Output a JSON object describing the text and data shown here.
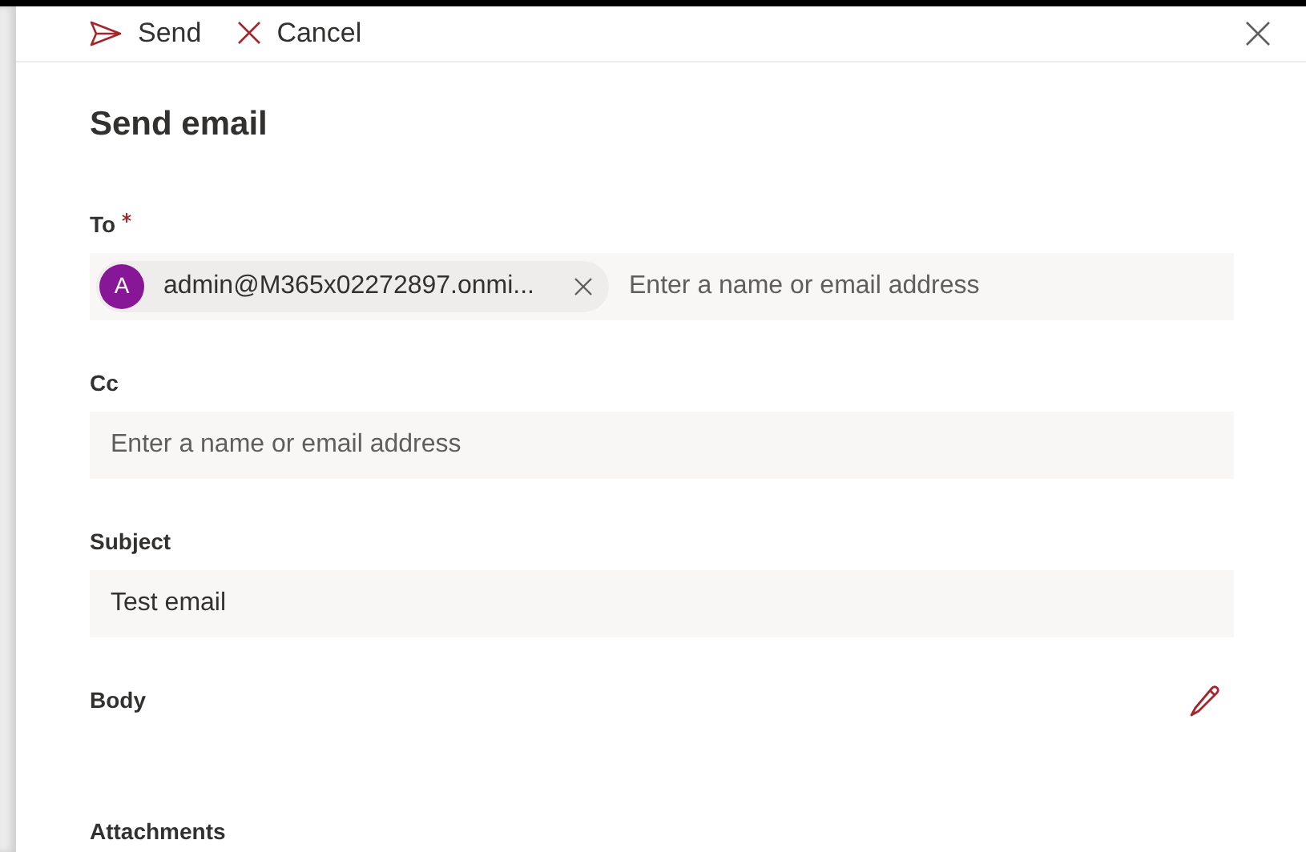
{
  "command_bar": {
    "buttons": [
      {
        "kind": "send",
        "label": "Send"
      },
      {
        "kind": "cancel",
        "label": "Cancel"
      }
    ]
  },
  "panel": {
    "title": "Send email"
  },
  "fields": [
    {
      "kind": "people",
      "label": "To",
      "required": true,
      "recipients": [
        {
          "initial": "A",
          "address": "admin@M365x02272897.onmi...",
          "color": "#881798"
        }
      ],
      "placeholder": "Enter a name or email address"
    },
    {
      "kind": "people",
      "label": "Cc",
      "required": false,
      "placeholder": "Enter a name or email address"
    },
    {
      "kind": "text",
      "label": "Subject",
      "required": false,
      "value": "Test email"
    },
    {
      "kind": "body",
      "label": "Body",
      "required": false
    },
    {
      "kind": "attachments",
      "label": "Attachments",
      "required": false
    }
  ]
}
